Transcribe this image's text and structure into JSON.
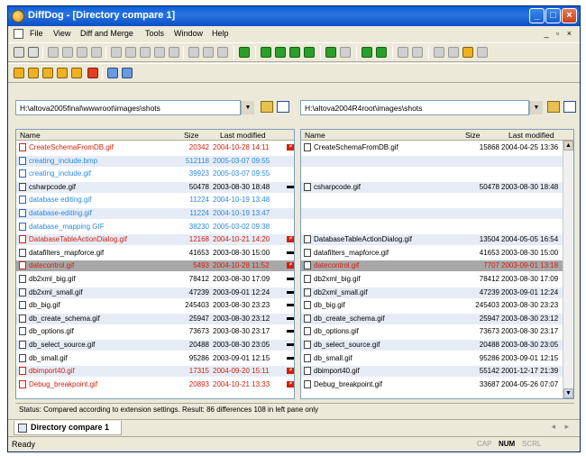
{
  "window": {
    "title": "DiffDog - [Directory compare 1]"
  },
  "menu": [
    "File",
    "View",
    "Diff and Merge",
    "Tools",
    "Window",
    "Help"
  ],
  "paths": {
    "left": "H:\\altova2005final\\wwwroot\\images\\shots",
    "right": "H:\\altova2004R4root\\images\\shots"
  },
  "columns": {
    "name": "Name",
    "size": "Size",
    "modified": "Last modified"
  },
  "left_rows": [
    {
      "name": "CreateSchemaFromDB.gif",
      "size": "20342",
      "date": "2004-10-28 14:11",
      "color": "red",
      "mark": "neq"
    },
    {
      "name": "creating_include.bmp",
      "size": "512118",
      "date": "2005-03-07 09:55",
      "color": "blue",
      "mark": ""
    },
    {
      "name": "creating_include.gif",
      "size": "39923",
      "date": "2005-03-07 09:55",
      "color": "blue",
      "mark": ""
    },
    {
      "name": "csharpcode.gif",
      "size": "50478",
      "date": "2003-08-30 18:48",
      "color": "blk",
      "mark": "eq"
    },
    {
      "name": "database editing.gif",
      "size": "11224",
      "date": "2004-10-19 13:48",
      "color": "blue",
      "mark": ""
    },
    {
      "name": "database-editing.gif",
      "size": "11224",
      "date": "2004-10-19 13:47",
      "color": "blue",
      "mark": ""
    },
    {
      "name": "database_mapping.GIF",
      "size": "38230",
      "date": "2005-03-02 09:38",
      "color": "blue",
      "mark": ""
    },
    {
      "name": "DatabaseTableActionDialog.gif",
      "size": "12168",
      "date": "2004-10-21 14:20",
      "color": "red",
      "mark": "neq"
    },
    {
      "name": "datafilters_mapforce.gif",
      "size": "41653",
      "date": "2003-08-30 15:00",
      "color": "blk",
      "mark": "eq"
    },
    {
      "name": "datecontrol.gif",
      "size": "5493",
      "date": "2004-10-28 11:52",
      "color": "red",
      "mark": "neq"
    },
    {
      "name": "db2xml_big.gif",
      "size": "78412",
      "date": "2003-08-30 17:09",
      "color": "blk",
      "mark": "eq"
    },
    {
      "name": "db2xml_small.gif",
      "size": "47239",
      "date": "2003-09-01 12:24",
      "color": "blk",
      "mark": "eq"
    },
    {
      "name": "db_big.gif",
      "size": "245403",
      "date": "2003-08-30 23:23",
      "color": "blk",
      "mark": "eq"
    },
    {
      "name": "db_create_schema.gif",
      "size": "25947",
      "date": "2003-08-30 23:12",
      "color": "blk",
      "mark": "eq"
    },
    {
      "name": "db_options.gif",
      "size": "73673",
      "date": "2003-08-30 23:17",
      "color": "blk",
      "mark": "eq"
    },
    {
      "name": "db_select_source.gif",
      "size": "20488",
      "date": "2003-08-30 23:05",
      "color": "blk",
      "mark": "eq"
    },
    {
      "name": "db_small.gif",
      "size": "95286",
      "date": "2003-09-01 12:15",
      "color": "blk",
      "mark": "eq"
    },
    {
      "name": "dbimport40.gif",
      "size": "17315",
      "date": "2004-09-20 15:11",
      "color": "red",
      "mark": "neq"
    },
    {
      "name": "Debug_breakpoint.gif",
      "size": "20893",
      "date": "2004-10-21 13:33",
      "color": "red",
      "mark": "neq"
    }
  ],
  "right_rows": [
    {
      "name": "CreateSchemaFromDB.gif",
      "size": "15868",
      "date": "2004-04-25 13:36",
      "color": "blk"
    },
    {
      "name": "",
      "size": "",
      "date": "",
      "color": "blk"
    },
    {
      "name": "",
      "size": "",
      "date": "",
      "color": "blk"
    },
    {
      "name": "csharpcode.gif",
      "size": "50478",
      "date": "2003-08-30 18:48",
      "color": "blk"
    },
    {
      "name": "",
      "size": "",
      "date": "",
      "color": "blk"
    },
    {
      "name": "",
      "size": "",
      "date": "",
      "color": "blk"
    },
    {
      "name": "",
      "size": "",
      "date": "",
      "color": "blk"
    },
    {
      "name": "DatabaseTableActionDialog.gif",
      "size": "13504",
      "date": "2004-05-05 16:54",
      "color": "blk"
    },
    {
      "name": "datafilters_mapforce.gif",
      "size": "41653",
      "date": "2003-08-30 15:00",
      "color": "blk"
    },
    {
      "name": "datecontrol.gif",
      "size": "7707",
      "date": "2003-09-01 13:18",
      "color": "red"
    },
    {
      "name": "db2xml_big.gif",
      "size": "78412",
      "date": "2003-08-30 17:09",
      "color": "blk"
    },
    {
      "name": "db2xml_small.gif",
      "size": "47239",
      "date": "2003-09-01 12:24",
      "color": "blk"
    },
    {
      "name": "db_big.gif",
      "size": "245403",
      "date": "2003-08-30 23:23",
      "color": "blk"
    },
    {
      "name": "db_create_schema.gif",
      "size": "25947",
      "date": "2003-08-30 23:12",
      "color": "blk"
    },
    {
      "name": "db_options.gif",
      "size": "73673",
      "date": "2003-08-30 23:17",
      "color": "blk"
    },
    {
      "name": "db_select_source.gif",
      "size": "20488",
      "date": "2003-08-30 23:05",
      "color": "blk"
    },
    {
      "name": "db_small.gif",
      "size": "95286",
      "date": "2003-09-01 12:15",
      "color": "blk"
    },
    {
      "name": "dbimport40.gif",
      "size": "55142",
      "date": "2001-12-17 21:39",
      "color": "blk"
    },
    {
      "name": "Debug_breakpoint.gif",
      "size": "33687",
      "date": "2004-05-26 07:07",
      "color": "blk"
    }
  ],
  "status_line": "Status: Compared according to extension settings. Result: 86 differences 108 in left pane only",
  "doc_tab": "Directory compare 1",
  "statusbar": {
    "ready": "Ready",
    "cap": "CAP",
    "num": "NUM",
    "scrl": "SCRL"
  },
  "colors": {
    "diff": "#d02010",
    "only_left": "#2a8ae0",
    "title_bar": "#0a5fd8"
  }
}
